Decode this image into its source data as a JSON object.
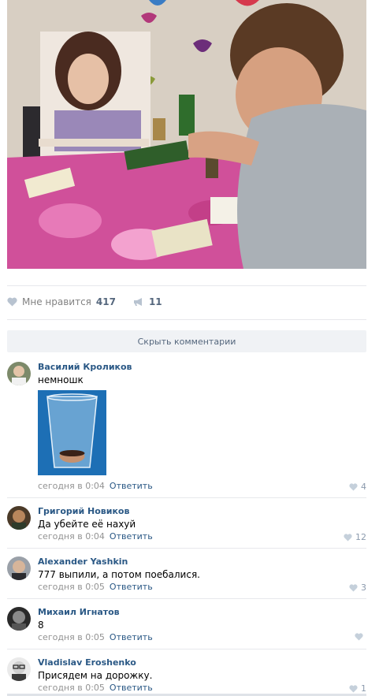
{
  "post": {
    "like_label": "Мне нравится",
    "like_count": "417",
    "share_count": "11",
    "icons": {
      "like": "heart-icon",
      "share": "megaphone-icon"
    }
  },
  "hide_comments_label": "Скрыть комментарии",
  "comments": [
    {
      "author": "Василий Кроликов",
      "text": "немношк",
      "time": "сегодня в 0:04",
      "reply": "Ответить",
      "likes": "4",
      "has_attachment": true
    },
    {
      "author": "Григорий Новиков",
      "text": "Да убейте её нахуй",
      "time": "сегодня в 0:04",
      "reply": "Ответить",
      "likes": "12"
    },
    {
      "author": "Alexander Yashkin",
      "text": "777 выпили, а потом поебалися.",
      "time": "сегодня в 0:05",
      "reply": "Ответить",
      "likes": "3"
    },
    {
      "author": "Михаил Игнатов",
      "text": "8",
      "time": "сегодня в 0:05",
      "reply": "Ответить",
      "likes": ""
    },
    {
      "author": "Vladislav Eroshenko",
      "text": "Присядем на дорожку.",
      "time": "сегодня в 0:05",
      "reply": "Ответить",
      "likes": "1"
    }
  ],
  "colors": {
    "link": "#2a5885",
    "meta": "#939393",
    "accent": "#55677d",
    "button_bg": "#f0f2f5"
  }
}
